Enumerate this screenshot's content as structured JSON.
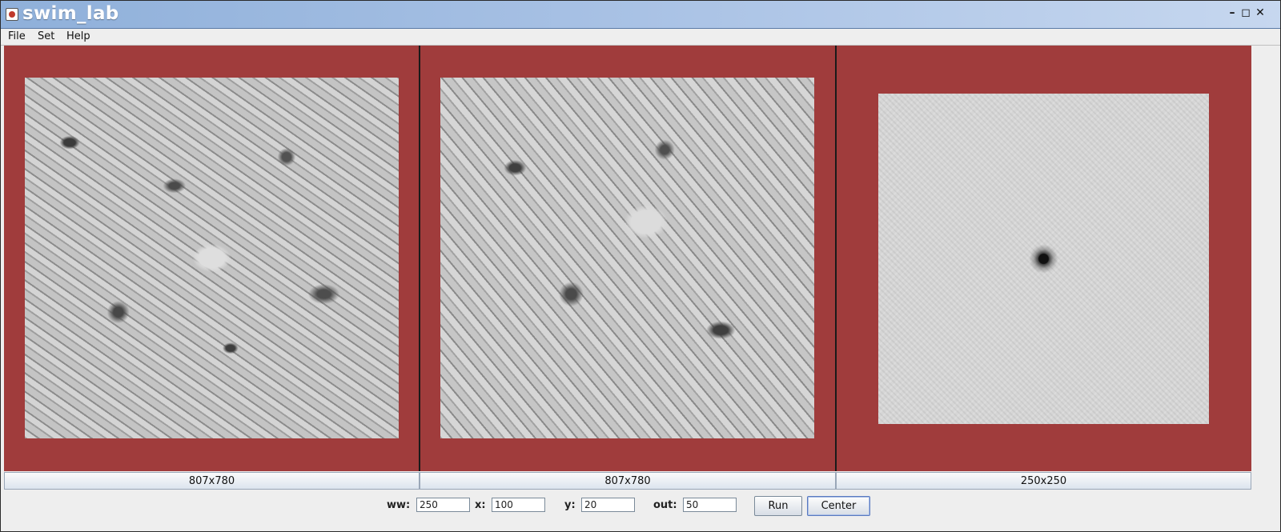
{
  "window": {
    "title": "swim_lab",
    "controls": {
      "minimize": "–",
      "maximize": "◻",
      "close": "✕"
    }
  },
  "menu": {
    "items": [
      "File",
      "Set",
      "Help"
    ]
  },
  "panels": [
    {
      "image_type": "electron-micrograph",
      "size_label": "807x780"
    },
    {
      "image_type": "electron-micrograph",
      "size_label": "807x780"
    },
    {
      "image_type": "correlation-map",
      "size_label": "250x250"
    }
  ],
  "colors": {
    "panel_background": "#a03c3c",
    "title_gradient_start": "#8fb0da",
    "title_gradient_end": "#c6d7ef"
  },
  "controls": {
    "ww": {
      "label": "ww:",
      "value": "250"
    },
    "x": {
      "label": "x:",
      "value": "100"
    },
    "y": {
      "label": "y:",
      "value": "20"
    },
    "out": {
      "label": "out:",
      "value": "50"
    },
    "run_label": "Run",
    "center_label": "Center"
  }
}
